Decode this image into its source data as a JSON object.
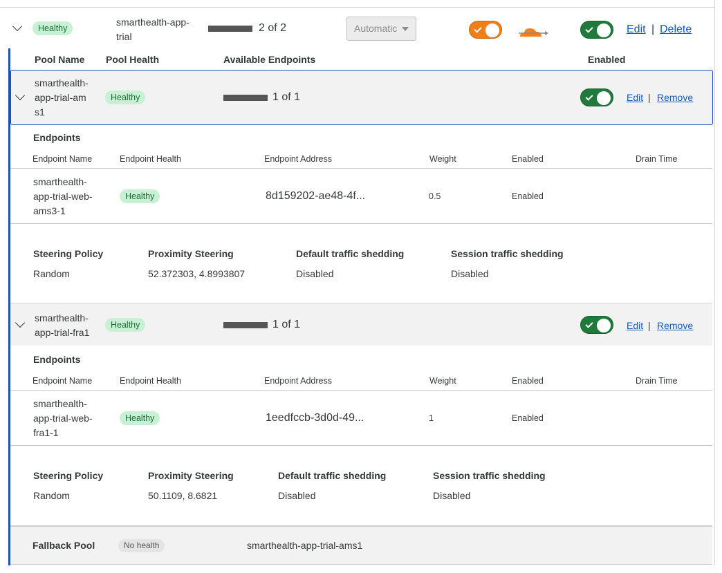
{
  "top_row": {
    "status": "Healthy",
    "name": "smarthealth-app-trial",
    "endpoints_count": "2 of 2",
    "steering_select": "Automatic",
    "edit_label": "Edit",
    "delete_label": "Delete",
    "separator": "|",
    "proxy_toggle_on": true,
    "enabled_toggle_on": true
  },
  "pool_table": {
    "headers": [
      "Pool Name",
      "Pool Health",
      "Available Endpoints",
      "Enabled"
    ]
  },
  "pools": [
    {
      "name_lines": [
        "smarthealth-",
        "app-trial-am",
        "s1"
      ],
      "health": "Healthy",
      "endpoints_count": "1 of 1",
      "enabled": true,
      "edit_label": "Edit",
      "remove_label": "Remove",
      "endpoints_title": "Endpoints",
      "endpoint_headers": [
        "Endpoint Name",
        "Endpoint Health",
        "Endpoint Address",
        "Weight",
        "Enabled",
        "Drain Time"
      ],
      "endpoint": {
        "name_lines": [
          "smarthealth-",
          "app-trial-web-",
          "ams3-1"
        ],
        "health": "Healthy",
        "address": "8d159202-ae48-4f...",
        "weight": "0.5",
        "enabled": "Enabled"
      },
      "settings_headers": [
        "Steering Policy",
        "Proximity Steering",
        "Default traffic shedding",
        "Session traffic shedding"
      ],
      "settings_values": [
        "Random",
        "52.372303, 4.8993807",
        "Disabled",
        "Disabled"
      ]
    },
    {
      "name_lines": [
        "smarthealth-",
        "app-trial-fra1"
      ],
      "health": "Healthy",
      "endpoints_count": "1 of 1",
      "enabled": true,
      "edit_label": "Edit",
      "remove_label": "Remove",
      "endpoints_title": "Endpoints",
      "endpoint_headers": [
        "Endpoint Name",
        "Endpoint Health",
        "Endpoint Address",
        "Weight",
        "Enabled",
        "Drain Time"
      ],
      "endpoint": {
        "name_lines": [
          "smarthealth-",
          "app-trial-web-",
          "fra1-1"
        ],
        "health": "Healthy",
        "address": "1eedfccb-3d0d-49...",
        "weight": "1",
        "enabled": "Enabled"
      },
      "settings_headers": [
        "Steering Policy",
        "Proximity Steering",
        "Default traffic shedding",
        "Session traffic shedding"
      ],
      "settings_values": [
        "Random",
        "50.1109, 8.6821",
        "Disabled",
        "Disabled"
      ]
    }
  ],
  "fallback": {
    "label": "Fallback Pool",
    "health": "No health",
    "pool": "smarthealth-app-trial-ams1"
  },
  "colors": {
    "healthy_bg": "#c8f0d4",
    "toggle_green": "#1f7a3b",
    "toggle_orange": "#f07f1a",
    "link": "#0b5ccb",
    "accent_border": "#1d4fbf",
    "cloud_orange": "#f38020"
  },
  "icons": [
    "chevron-down-icon",
    "cloud-proxy-icon",
    "check-icon",
    "dropdown-caret-icon"
  ]
}
